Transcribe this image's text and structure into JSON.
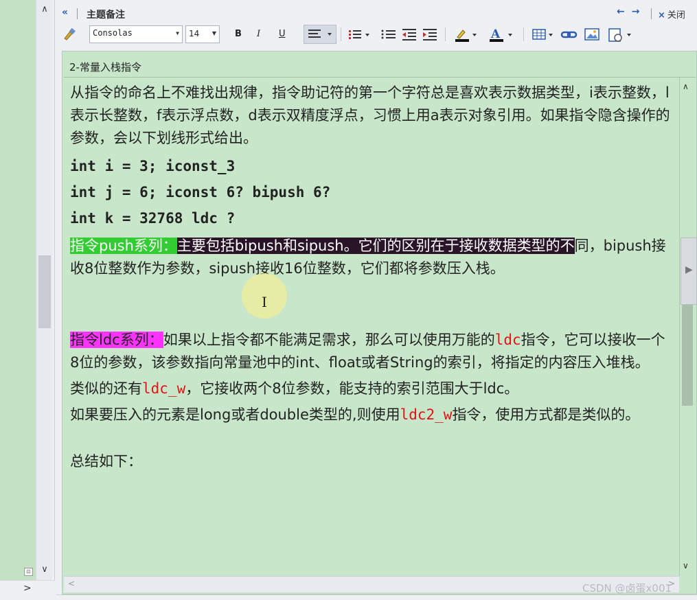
{
  "left_panel": {
    "up_arrow": "∧",
    "down_arrow": "∨",
    "right_arrow": ">"
  },
  "header": {
    "collapse_icon": "«",
    "title": "主题备注",
    "nav_prev": "←",
    "nav_next": "→",
    "close_icon": "×",
    "close_label": "关闭"
  },
  "toolbar": {
    "font_name": "Consolas",
    "font_size": "14",
    "bold": "B",
    "italic": "I",
    "underline": "U"
  },
  "editor": {
    "title": "2-常量入栈指令",
    "para1": "从指令的命名上不难找出规律，指令助记符的第一个字符总是喜欢表示数据类型，i表示整数，l表示长整数，f表示浮点数，d表示双精度浮点，习惯上用a表示对象引用。如果指令隐含操作的参数，会以下划线形式给出。",
    "code1": "int i = 3;   iconst_3",
    "code2": "int j = 6;   iconst 6? bipush 6?",
    "code3": "int k = 32768 ldc ?",
    "push_label": "指令push系列：",
    "push_dark": "主要包括bipush和sipush。它们的区别在于接收数据类型的不",
    "push_rest": "同，bipush接收8位整数作为参数，sipush接收16位整数，它们都将参数压入栈。",
    "ldc_label": "指令ldc系列：",
    "ldc_a": "如果以上指令都不能满足需求，那么可以使用万能的",
    "ldc_red": "ldc",
    "ldc_b": "指令，它可以接收一个8位的参数，该参数指向常量池中的int、float或者String的索引，将指定的内容压入堆栈。",
    "similar_a": "类似的还有",
    "similar_red": "ldc_w",
    "similar_b": "，它接收两个8位参数，能支持的索引范围大于ldc。",
    "long_a": "如果要压入的元素是long或者double类型的,则使用",
    "long_red": "ldc2_w",
    "long_b": "指令，使用方式都是类似的。",
    "summary": "总结如下："
  },
  "colors": {
    "editor_bg": "#c8e6ca",
    "highlight_green": "#33cc33",
    "highlight_dark": "#2a1428",
    "highlight_magenta": "#ff33ff",
    "red_text": "#e01414"
  },
  "watermark": "CSDN @卤蛋x001"
}
